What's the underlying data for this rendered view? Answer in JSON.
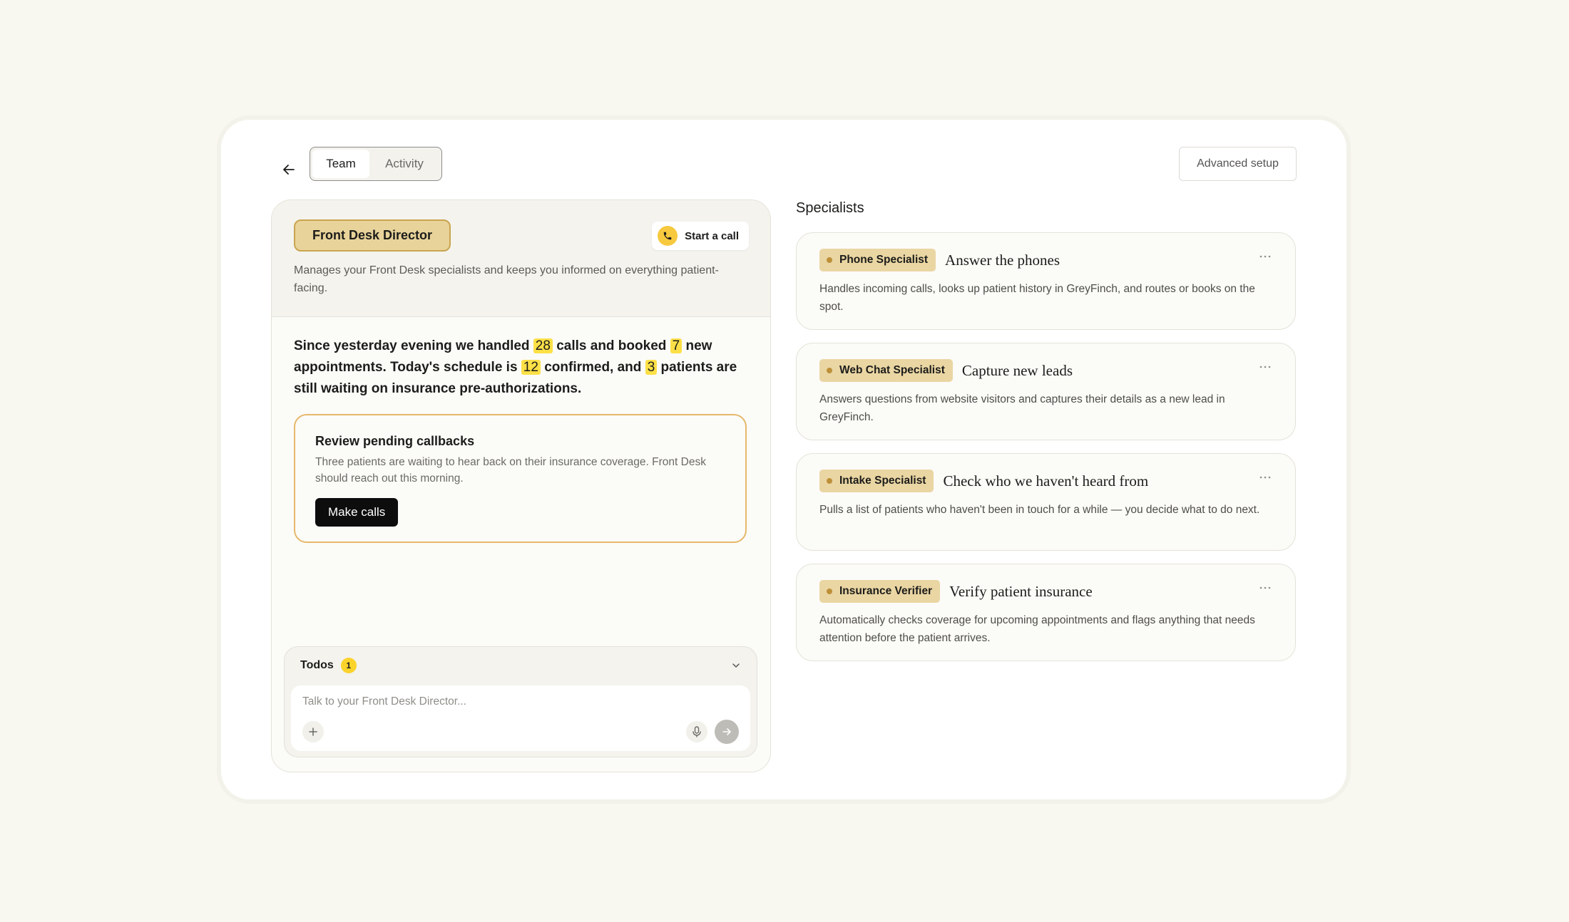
{
  "header": {
    "tabs": [
      {
        "label": "Team",
        "active": true
      },
      {
        "label": "Activity",
        "active": false
      }
    ],
    "advanced_setup_label": "Advanced setup",
    "back_icon": "arrow-left-icon"
  },
  "director": {
    "badge": "Front Desk Director",
    "start_call_label": "Start a call",
    "description": "Manages your Front Desk specialists and keeps you informed on everything patient-facing.",
    "summary": {
      "p1": "Since yesterday evening we handled ",
      "calls": "28",
      "p2": " calls and booked ",
      "booked": "7",
      "p3": " new appointments. Today's schedule is ",
      "confirmed": "12",
      "p4": " confirmed, and ",
      "waiting": "3",
      "p5": " patients are still waiting on insurance pre-authorizations."
    },
    "callback_card": {
      "title": "Review pending callbacks",
      "text": "Three patients are waiting to hear back on their insurance coverage. Front Desk should reach out this morning.",
      "button": "Make calls"
    },
    "chat": {
      "todos_label": "Todos",
      "todos_count": "1",
      "placeholder": "Talk to your Front Desk Director..."
    }
  },
  "specialists": {
    "title": "Specialists",
    "items": [
      {
        "badge": "Phone Specialist",
        "heading": "Answer the phones",
        "description": "Handles incoming calls, looks up patient history in GreyFinch, and routes or books on the spot."
      },
      {
        "badge": "Web Chat Specialist",
        "heading": "Capture new leads",
        "description": "Answers questions from website visitors and captures their details as a new lead in GreyFinch."
      },
      {
        "badge": "Intake Specialist",
        "heading": "Check who we haven't heard from",
        "description": "Pulls a list of patients who haven't been in touch for a while — you decide what to do next."
      },
      {
        "badge": "Insurance Verifier",
        "heading": "Verify patient insurance",
        "description": "Automatically checks coverage for upcoming appointments and flags anything that needs attention before the patient arrives."
      }
    ]
  },
  "colors": {
    "page_bg": "#f8f7f0",
    "accent_gold": "#e8d39a",
    "highlight_yellow": "#fde047",
    "callback_border": "#e6b86b"
  }
}
